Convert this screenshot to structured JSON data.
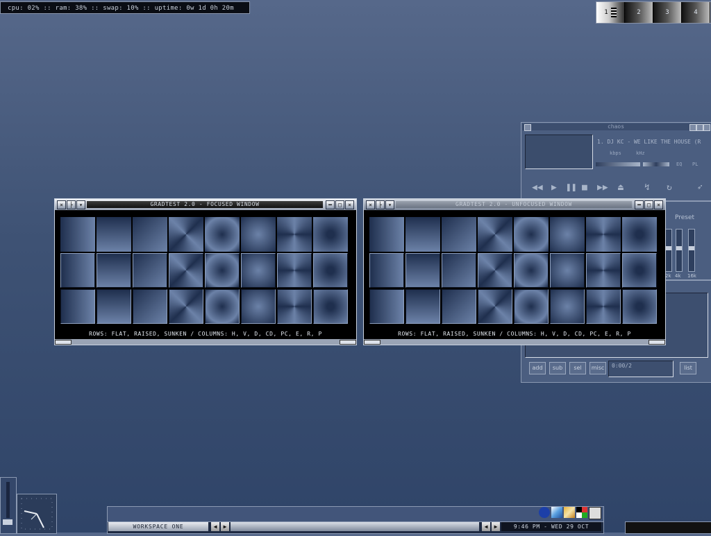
{
  "sysmon": {
    "text": "cpu: 02% :: ram: 38% :: swap: 10% :: uptime: 0w 1d 0h 20m"
  },
  "pager": {
    "desktops": [
      "1",
      "2",
      "3",
      "4"
    ],
    "active": 1
  },
  "player": {
    "title": "chaos",
    "song": "1. DJ KC - WE LIKE THE HOUSE (R",
    "kbps_label": "kbps",
    "khz_label": "kHz",
    "eq_button": "EQ",
    "pl_button": "PL",
    "eq_preset": "Preset",
    "eq_bands": [
      "2k",
      "4k",
      "16k"
    ],
    "playlist_buttons": [
      "add",
      "sub",
      "sel",
      "misc",
      "list"
    ],
    "playlist_time": "0:00/2"
  },
  "windows": [
    {
      "title": "GRADTEST 2.0 - FOCUSED WINDOW",
      "state": "focused",
      "caption": "ROWS: FLAT, RAISED, SUNKEN / COLUMNS: H, V, D, CD, PC, E, R, P"
    },
    {
      "title": "GRADTEST 2.0 - UNFOCUSED WINDOW",
      "state": "unfocused",
      "caption": "ROWS: FLAT, RAISED, SUNKEN / COLUMNS: H, V, D, CD, PC, E, R, P"
    }
  ],
  "gradient_columns": [
    "H",
    "V",
    "D",
    "CD",
    "PC",
    "E",
    "R",
    "P"
  ],
  "gradient_rows": [
    "FLAT",
    "RAISED",
    "SUNKEN"
  ],
  "taskbar": {
    "workspace": "WORKSPACE ONE",
    "clock": "9:46 PM - WED 29 OCT"
  },
  "colors": {
    "desktop": "#3e5274",
    "gradient_dark": "#1f2f4e",
    "gradient_light": "#6c82a8"
  }
}
